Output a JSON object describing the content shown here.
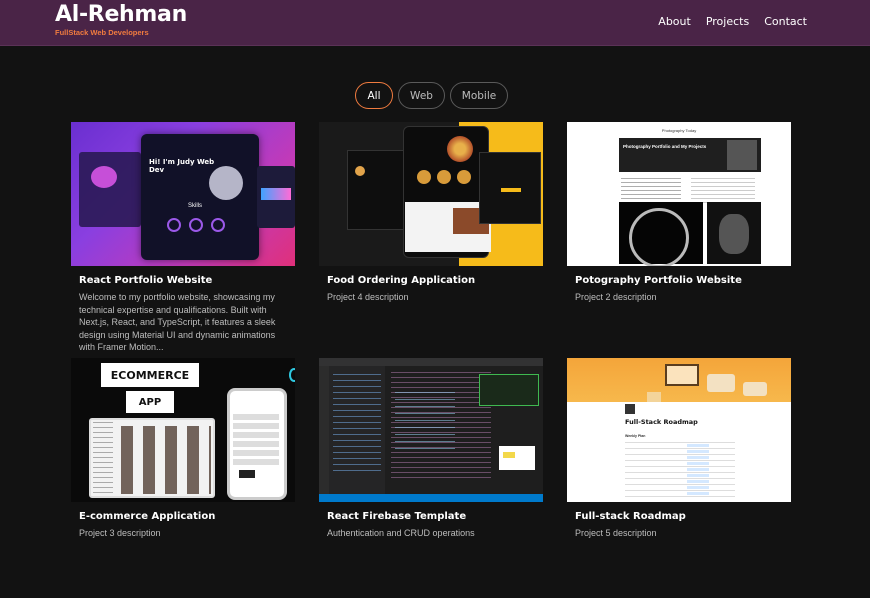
{
  "brand": {
    "name": "Al-Rehman",
    "tagline": "FullStack Web Developers"
  },
  "nav": {
    "items": [
      "About",
      "Projects",
      "Contact"
    ]
  },
  "filters": {
    "items": [
      "All",
      "Web",
      "Mobile"
    ],
    "active": "All"
  },
  "projects": [
    {
      "title": "React Portfolio Website",
      "description": "Welcome to my portfolio website, showcasing my technical expertise and qualifications. Built with Next.js, React, and TypeScript, it features a sleek design using Material UI and dynamic animations with Framer Motion..."
    },
    {
      "title": "Food Ordering Application",
      "description": "Project 4 description"
    },
    {
      "title": "Potography Portfolio Website",
      "description": "Project 2 description"
    },
    {
      "title": "E-commerce Application",
      "description": "Project 3 description"
    },
    {
      "title": "React Firebase Template",
      "description": "Authentication and CRUD operations"
    },
    {
      "title": "Full-stack Roadmap",
      "description": "Project 5 description"
    }
  ],
  "thumbs": {
    "portfolio": {
      "hero": "Hi! I'm Judy Web Dev",
      "skills": "Skills"
    },
    "photo": {
      "banner": "Photography Portfolio and My Projects",
      "header": "Photography Today"
    },
    "ecommerce": {
      "top": "ECOMMERCE",
      "bottom": "APP"
    },
    "roadmap": {
      "heading": "Full-Stack Roadmap",
      "sub": "Weekly Plan"
    }
  },
  "colors": {
    "navbar": "#4a2447",
    "accent": "#f07b3f",
    "background": "#121212"
  }
}
